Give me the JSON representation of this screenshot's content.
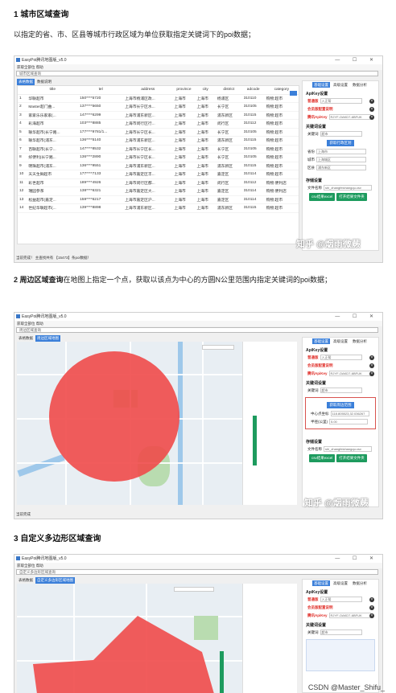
{
  "section1": {
    "heading": "1 城市区域查询",
    "desc": "以指定的省、市、区县等城市行政区域为单位获取指定关键词下的poi数据；"
  },
  "section2": {
    "heading_bold": "2 周边区域查询",
    "desc": "在地图上指定一个点，获取以该点为中心的方圆N公里范围内指定关键词的poi数据；"
  },
  "section3": {
    "heading": "3 自定义多边形区域查询"
  },
  "app": {
    "title": "EasyPoi腾讯地图版_v5.0",
    "menu": "获取全部位 帮助",
    "combo_city": "城市区域查询",
    "combo_around": "周边区域查询",
    "combo_polygon": "自定义多边形区域查询",
    "tab_table": "表格数据",
    "tab_info": "数据说明",
    "tab_around": "周边区域地图",
    "tab_polygon": "自定义多边形区域地图",
    "win_controls": "— ☐ ✕",
    "right_tabs": [
      "基础设置",
      "高级设置",
      "数据分析"
    ],
    "apikey_title": "ApiKey设置",
    "normal_label": "普通版",
    "normal_value": "入正帮",
    "vip_label": "会员版配置说明",
    "vip_key_label": "腾讯ApiKey",
    "vip_key_value": "RJYF-OAKD7-6BFUK",
    "keyword_title": "关键词设置",
    "keyword_label": "关键词",
    "keyword_value": "超市",
    "region_btn": "获取行政区划",
    "prov_label": "省份",
    "prov_value": "上海市",
    "city_label": "城市",
    "city_value": "上海城区",
    "district_label": "区县",
    "district_value": "浦东新区",
    "storage_title": "存储设置",
    "file_label": "文件名称",
    "file_value": "shi_zhangfeichangqu.csv",
    "btn_csv": "csv结果excel",
    "btn_open": "打开结果文件夹",
    "status_city": "当前完成！ 主查找共有 【15473】条poi数据！",
    "status_done": "当前完成",
    "center_label": "中心点坐标",
    "center_value": "118.805523,32.036267",
    "radius_label": "半径(公里)",
    "radius_value": "5.00",
    "around_btn": "获取周边范围"
  },
  "table": {
    "headers": [
      "",
      "title",
      "tel",
      "address",
      "province",
      "city",
      "district",
      "adcode",
      "category"
    ],
    "rows": [
      [
        "1",
        "华联超市",
        "150****5720",
        "上海市杨浦区政...",
        "上海市",
        "上海市",
        "杨浦区",
        "310110",
        "购物:超市"
      ],
      [
        "2",
        "Master超门曲...",
        "137****5650",
        "上海市长宁区水...",
        "上海市",
        "上海市",
        "长宁区",
        "310105",
        "购物:超市"
      ],
      [
        "3",
        "家家乐乐家家(...",
        "147****6299",
        "上海市浦东新区...",
        "上海市",
        "上海市",
        "浦东新区",
        "310115",
        "购物:超市"
      ],
      [
        "4",
        "彩海超市",
        "103****8885",
        "上海市闵行区行...",
        "上海市",
        "上海市",
        "闵行区",
        "310112",
        "购物:超市"
      ],
      [
        "5",
        "联华超市(长宁路...",
        "177****9781/1...",
        "上海市长宁区长...",
        "上海市",
        "上海市",
        "长宁区",
        "310105",
        "购物:超市"
      ],
      [
        "6",
        "联华超市(浦东...",
        "136****5140",
        "上海市浦东新区...",
        "上海市",
        "上海市",
        "浦东新区",
        "310115",
        "购物:超市"
      ],
      [
        "7",
        "百联超市(长宁...",
        "147****8532",
        "上海市长宁区长...",
        "上海市",
        "上海市",
        "长宁区",
        "310105",
        "购物:超市"
      ],
      [
        "8",
        "好便利(长宁路...",
        "136****2890",
        "上海市长宁区长...",
        "上海市",
        "上海市",
        "长宁区",
        "310105",
        "购物:超市"
      ],
      [
        "9",
        "明珠超市(浦东...",
        "136****9551",
        "上海市浦东新区...",
        "上海市",
        "上海市",
        "浦东新区",
        "310115",
        "购物:超市"
      ],
      [
        "10",
        "天天生鲜超市",
        "177****7133",
        "上海市嘉定区丰...",
        "上海市",
        "上海市",
        "嘉定区",
        "310114",
        "购物:超市"
      ],
      [
        "11",
        "彩世超市",
        "189****4926",
        "上海市闵行区都...",
        "上海市",
        "上海市",
        "闵行区",
        "310112",
        "购物:便利店"
      ],
      [
        "12",
        "瑞园参茶",
        "138****6321",
        "上海市嘉定区大...",
        "上海市",
        "上海市",
        "嘉定区",
        "310114",
        "购物:便利店"
      ],
      [
        "13",
        "松益超市(嘉定...",
        "159****6217",
        "上海市嘉定区沪...",
        "上海市",
        "上海市",
        "嘉定区",
        "310114",
        "购物:超市"
      ],
      [
        "14",
        "世纪华联超市(...",
        "139****8898",
        "上海市浦东新区...",
        "上海市",
        "上海市",
        "浦东新区",
        "310115",
        "购物:超市"
      ]
    ]
  },
  "watermark": "知乎 @烟雨微蕨",
  "csdn": "CSDN @Master_Shifu_",
  "colors": {
    "accent": "#3b7fd9",
    "green": "#1d9b5e",
    "red": "#e0302a",
    "circle": "#f04a4a"
  }
}
